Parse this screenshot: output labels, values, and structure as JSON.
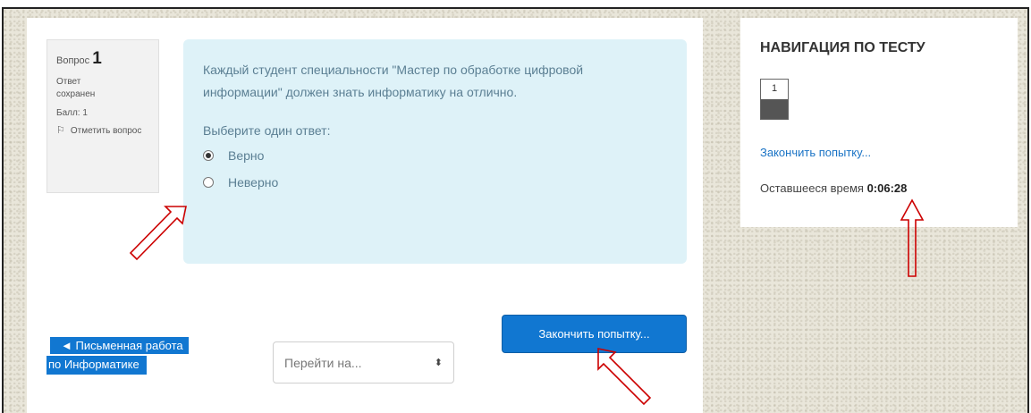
{
  "question_info": {
    "label": "Вопрос",
    "number": "1",
    "state": "Ответ сохранен",
    "grade": "Балл: 1",
    "flag_label": "Отметить вопрос"
  },
  "question": {
    "text": "Каждый студент специальности \"Мастер по обработке цифровой информации\" должен знать информатику на отлично.",
    "prompt": "Выберите один ответ:",
    "answers": [
      {
        "label": "Верно",
        "selected": true
      },
      {
        "label": "Неверно",
        "selected": false
      }
    ]
  },
  "footer": {
    "prev_line1": "◄ Письменная работа",
    "prev_line2": "по Информатике",
    "jump_placeholder": "Перейти на...",
    "finish_button": "Закончить попытку..."
  },
  "navigation": {
    "title": "НАВИГАЦИЯ ПО ТЕСТУ",
    "question_buttons": [
      "1"
    ],
    "finish_link": "Закончить попытку...",
    "time_label": "Оставшееся время",
    "time_value": "0:06:28"
  },
  "colors": {
    "accent_blue": "#1177d1",
    "question_bg": "#def2f8",
    "annotation_arrow": "#cc0000"
  }
}
